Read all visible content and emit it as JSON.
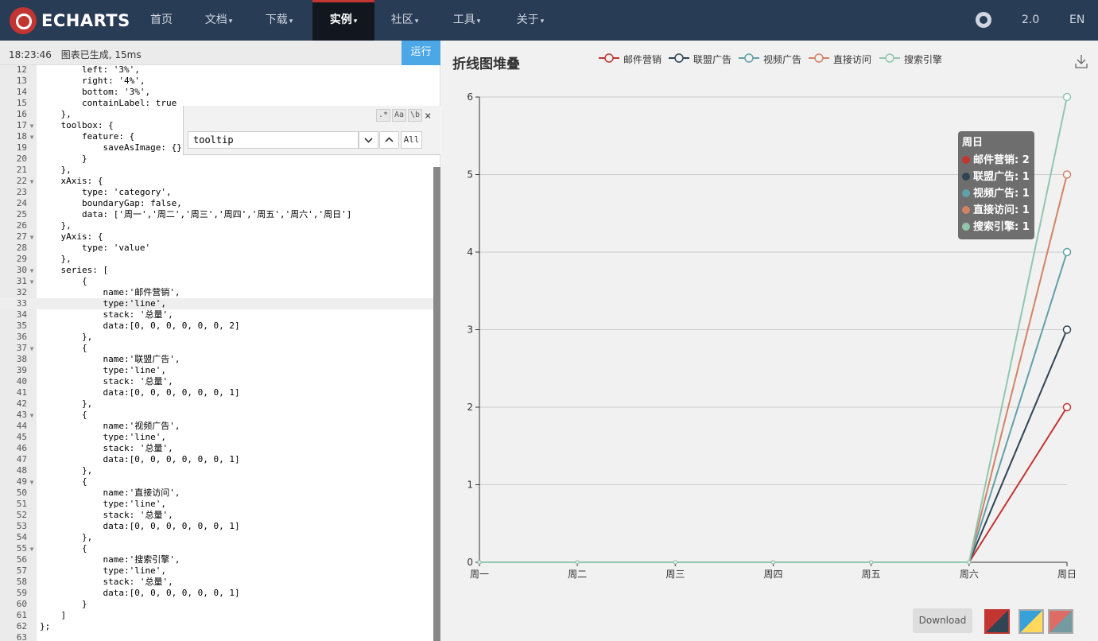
{
  "nav": {
    "logo_text": "ECHARTS",
    "items": [
      {
        "label": "首页",
        "dropdown": false,
        "active": false
      },
      {
        "label": "文档",
        "dropdown": true,
        "active": false
      },
      {
        "label": "下载",
        "dropdown": true,
        "active": false
      },
      {
        "label": "实例",
        "dropdown": true,
        "active": true
      },
      {
        "label": "社区",
        "dropdown": true,
        "active": false
      },
      {
        "label": "工具",
        "dropdown": true,
        "active": false
      },
      {
        "label": "关于",
        "dropdown": true,
        "active": false
      }
    ],
    "github_icon": "github-icon",
    "version": "2.0",
    "lang": "EN"
  },
  "editor": {
    "status_time": "18:23:46",
    "status_msg": "图表已生成, 15ms",
    "run_label": "运行",
    "active_line": 33,
    "lines": [
      {
        "n": 12,
        "fold": false,
        "text": "        left: '3%',"
      },
      {
        "n": 13,
        "fold": false,
        "text": "        right: '4%',"
      },
      {
        "n": 14,
        "fold": false,
        "text": "        bottom: '3%',"
      },
      {
        "n": 15,
        "fold": false,
        "text": "        containLabel: true"
      },
      {
        "n": 16,
        "fold": false,
        "text": "    },"
      },
      {
        "n": 17,
        "fold": true,
        "text": "    toolbox: {"
      },
      {
        "n": 18,
        "fold": true,
        "text": "        feature: {"
      },
      {
        "n": 19,
        "fold": false,
        "text": "            saveAsImage: {}"
      },
      {
        "n": 20,
        "fold": false,
        "text": "        }"
      },
      {
        "n": 21,
        "fold": false,
        "text": "    },"
      },
      {
        "n": 22,
        "fold": true,
        "text": "    xAxis: {"
      },
      {
        "n": 23,
        "fold": false,
        "text": "        type: 'category',"
      },
      {
        "n": 24,
        "fold": false,
        "text": "        boundaryGap: false,"
      },
      {
        "n": 25,
        "fold": false,
        "text": "        data: ['周一','周二','周三','周四','周五','周六','周日']"
      },
      {
        "n": 26,
        "fold": false,
        "text": "    },"
      },
      {
        "n": 27,
        "fold": true,
        "text": "    yAxis: {"
      },
      {
        "n": 28,
        "fold": false,
        "text": "        type: 'value'"
      },
      {
        "n": 29,
        "fold": false,
        "text": "    },"
      },
      {
        "n": 30,
        "fold": true,
        "text": "    series: ["
      },
      {
        "n": 31,
        "fold": true,
        "text": "        {"
      },
      {
        "n": 32,
        "fold": false,
        "text": "            name:'邮件营销',"
      },
      {
        "n": 33,
        "fold": false,
        "text": "            type:'line',"
      },
      {
        "n": 34,
        "fold": false,
        "text": "            stack: '总量',"
      },
      {
        "n": 35,
        "fold": false,
        "text": "            data:[0, 0, 0, 0, 0, 0, 2]"
      },
      {
        "n": 36,
        "fold": false,
        "text": "        },"
      },
      {
        "n": 37,
        "fold": true,
        "text": "        {"
      },
      {
        "n": 38,
        "fold": false,
        "text": "            name:'联盟广告',"
      },
      {
        "n": 39,
        "fold": false,
        "text": "            type:'line',"
      },
      {
        "n": 40,
        "fold": false,
        "text": "            stack: '总量',"
      },
      {
        "n": 41,
        "fold": false,
        "text": "            data:[0, 0, 0, 0, 0, 0, 1]"
      },
      {
        "n": 42,
        "fold": false,
        "text": "        },"
      },
      {
        "n": 43,
        "fold": true,
        "text": "        {"
      },
      {
        "n": 44,
        "fold": false,
        "text": "            name:'视频广告',"
      },
      {
        "n": 45,
        "fold": false,
        "text": "            type:'line',"
      },
      {
        "n": 46,
        "fold": false,
        "text": "            stack: '总量',"
      },
      {
        "n": 47,
        "fold": false,
        "text": "            data:[0, 0, 0, 0, 0, 0, 1]"
      },
      {
        "n": 48,
        "fold": false,
        "text": "        },"
      },
      {
        "n": 49,
        "fold": true,
        "text": "        {"
      },
      {
        "n": 50,
        "fold": false,
        "text": "            name:'直接访问',"
      },
      {
        "n": 51,
        "fold": false,
        "text": "            type:'line',"
      },
      {
        "n": 52,
        "fold": false,
        "text": "            stack: '总量',"
      },
      {
        "n": 53,
        "fold": false,
        "text": "            data:[0, 0, 0, 0, 0, 0, 1]"
      },
      {
        "n": 54,
        "fold": false,
        "text": "        },"
      },
      {
        "n": 55,
        "fold": true,
        "text": "        {"
      },
      {
        "n": 56,
        "fold": false,
        "text": "            name:'搜索引擎',"
      },
      {
        "n": 57,
        "fold": false,
        "text": "            type:'line',"
      },
      {
        "n": 58,
        "fold": false,
        "text": "            stack: '总量',"
      },
      {
        "n": 59,
        "fold": false,
        "text": "            data:[0, 0, 0, 0, 0, 0, 1]"
      },
      {
        "n": 60,
        "fold": false,
        "text": "        }"
      },
      {
        "n": 61,
        "fold": false,
        "text": "    ]"
      },
      {
        "n": 62,
        "fold": false,
        "text": "};"
      },
      {
        "n": 63,
        "fold": false,
        "text": ""
      }
    ],
    "search": {
      "value": "tooltip",
      "opt_regex": ".*",
      "opt_case": "Aa",
      "opt_word": "\\b",
      "down": "⌄",
      "up": "⌃",
      "all_label": "All",
      "close": "×"
    }
  },
  "chart_data": {
    "type": "line",
    "title": "折线图堆叠",
    "categories": [
      "周一",
      "周二",
      "周三",
      "周四",
      "周五",
      "周六",
      "周日"
    ],
    "ylim": [
      0,
      6
    ],
    "yticks": [
      0,
      1,
      2,
      3,
      4,
      5,
      6
    ],
    "stacked": true,
    "grid": true,
    "legend_position": "top",
    "series": [
      {
        "name": "邮件营销",
        "values": [
          0,
          0,
          0,
          0,
          0,
          0,
          2
        ],
        "color": "#c23531"
      },
      {
        "name": "联盟广告",
        "values": [
          0,
          0,
          0,
          0,
          0,
          0,
          1
        ],
        "color": "#2f4554"
      },
      {
        "name": "视频广告",
        "values": [
          0,
          0,
          0,
          0,
          0,
          0,
          1
        ],
        "color": "#61a0a8"
      },
      {
        "name": "直接访问",
        "values": [
          0,
          0,
          0,
          0,
          0,
          0,
          1
        ],
        "color": "#d48265"
      },
      {
        "name": "搜索引擎",
        "values": [
          0,
          0,
          0,
          0,
          0,
          0,
          1
        ],
        "color": "#91c7ae"
      }
    ],
    "tooltip": {
      "title": "周日",
      "rows": [
        "邮件营销: 2",
        "联盟广告: 1",
        "视频广告: 1",
        "直接访问: 1",
        "搜索引擎: 1"
      ]
    }
  },
  "chart_ui": {
    "download_label": "Download",
    "download_icon": "download-icon",
    "themes": [
      {
        "name": "theme-default",
        "colors": [
          "#c23531",
          "#2f4554"
        ],
        "selected": true
      },
      {
        "name": "theme-light",
        "colors": [
          "#37a2da",
          "#ffd85c"
        ],
        "selected": false
      },
      {
        "name": "theme-dark",
        "colors": [
          "#dd6b66",
          "#759aa0"
        ],
        "selected": false
      }
    ]
  }
}
